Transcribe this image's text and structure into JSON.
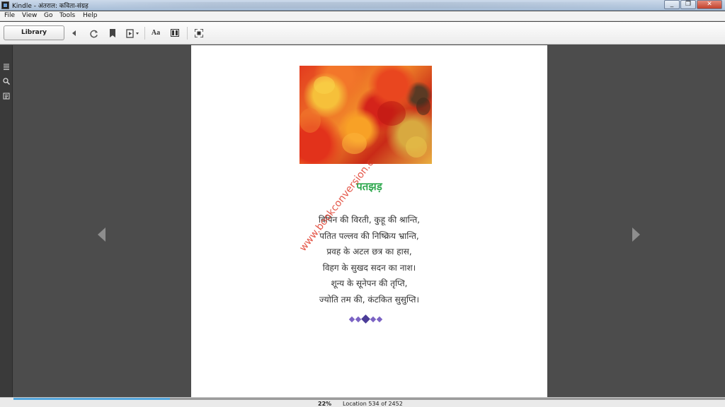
{
  "window": {
    "title": "Kindle - अंतराल: कविता-संग्रह",
    "controls": [
      "_",
      "❐",
      "✕"
    ]
  },
  "menu": {
    "file": "File",
    "view": "View",
    "go": "Go",
    "tools": "Tools",
    "help": "Help"
  },
  "toolbar": {
    "library": "Library",
    "aa": "Aa",
    "icons": [
      "back-arrow-icon",
      "sync-icon",
      "bookmark-icon",
      "goto-icon",
      "font-icon",
      "columns-icon",
      "fullscreen-icon"
    ]
  },
  "sidebar": {
    "icons": [
      "toc-icon",
      "search-icon",
      "notes-icon"
    ]
  },
  "page": {
    "title": "पतझड़",
    "lines": [
      "विपिन की विरती, कुहू की श्रान्ति,",
      "पतित पल्लव की निष्क्रिय भ्रान्ति,",
      "प्रवह के अटल छत्र का हास,",
      "विहग के सुखद सदन का नाश।",
      "शून्य के सूनेपन की तृप्ति,",
      "ज्योति तम की, कंटकित सुसुप्ति।"
    ],
    "watermark": "www.bookconversion.c"
  },
  "status": {
    "percent": "22%",
    "location": "Location 534 of 2452",
    "progress": 0.22
  },
  "colors": {
    "title_green": "#2ea84e",
    "watermark_red": "#e03a2a",
    "progress_blue": "#55a7dd"
  }
}
